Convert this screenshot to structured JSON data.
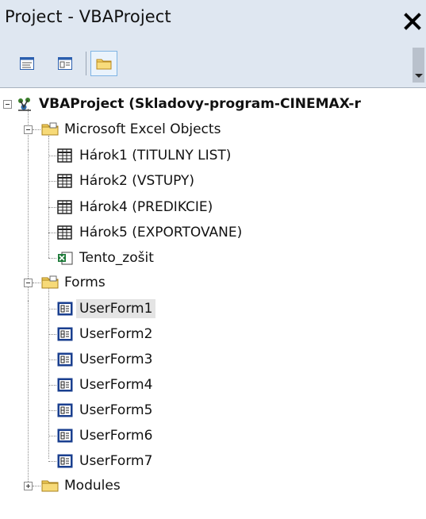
{
  "window": {
    "title": "Project - VBAProject",
    "close_icon": "close-icon"
  },
  "toolbar": {
    "buttons": [
      {
        "name": "view-code-button",
        "icon": "view-code-icon"
      },
      {
        "name": "view-object-button",
        "icon": "view-object-icon"
      },
      {
        "name": "toggle-folders-button",
        "icon": "folder-icon",
        "active": true
      }
    ]
  },
  "tree": {
    "project": {
      "label": "VBAProject (Skladovy-program-CINEMAX-r",
      "icon": "vba-project-icon"
    },
    "excel_objects": {
      "label": "Microsoft Excel Objects",
      "items": [
        "Hárok1 (TITULNY LIST)",
        "Hárok2 (VSTUPY)",
        "Hárok4 (PREDIKCIE)",
        "Hárok5 (EXPORTOVANE)",
        "Tento_zošit"
      ]
    },
    "forms": {
      "label": "Forms",
      "items": [
        "UserForm1",
        "UserForm2",
        "UserForm3",
        "UserForm4",
        "UserForm5",
        "UserForm6",
        "UserForm7"
      ],
      "selected": "UserForm1"
    },
    "modules": {
      "label": "Modules",
      "expanded": false
    }
  },
  "colors": {
    "chrome_bg": "#dfe7f1",
    "selection_bg": "#e4e4e4",
    "form_icon_blue": "#1a3f8f"
  }
}
